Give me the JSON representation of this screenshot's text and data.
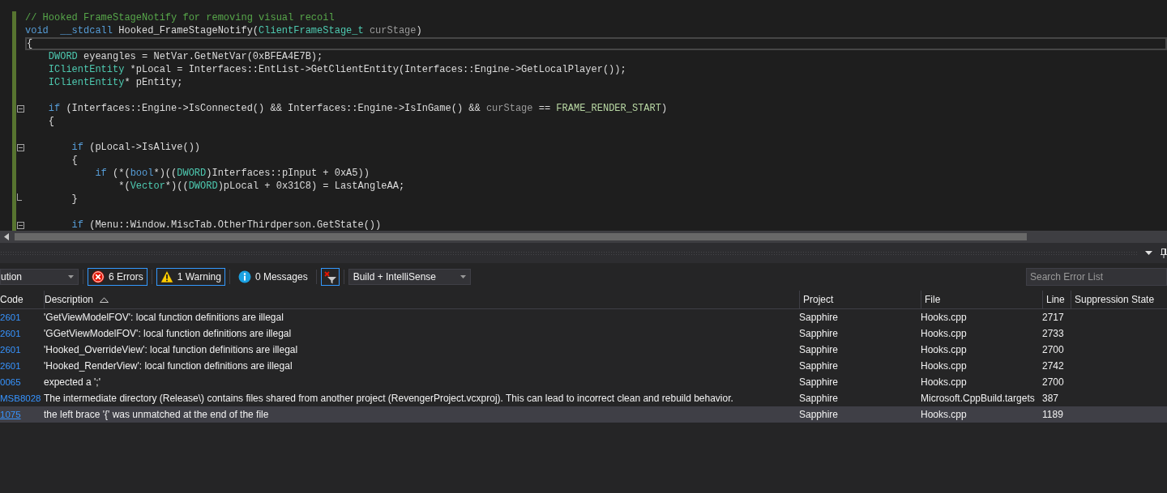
{
  "editor": {
    "lines": [
      {
        "changed": true,
        "tokens": [
          {
            "text": "// Hooked FrameStageNotify for removing visual recoil",
            "kind": "comment"
          }
        ]
      },
      {
        "changed": true,
        "tokens": [
          {
            "text": "void",
            "kind": "keyword"
          },
          {
            "text": "  __stdcall",
            "kind": "keyword"
          },
          {
            "text": " Hooked_FrameStageNotify(",
            "kind": "plain"
          },
          {
            "text": "ClientFrameStage_t",
            "kind": "type"
          },
          {
            "text": " curStage",
            "kind": "param"
          },
          {
            "text": ")",
            "kind": "plain"
          }
        ]
      },
      {
        "changed": true,
        "current": true,
        "tokens": [
          {
            "text": "{",
            "kind": "plain"
          }
        ]
      },
      {
        "changed": true,
        "tokens": [
          {
            "text": "    DWORD",
            "kind": "type"
          },
          {
            "text": " eyeangles = NetVar.GetNetVar(0xBFEA4E7B);",
            "kind": "plain"
          }
        ]
      },
      {
        "changed": true,
        "tokens": [
          {
            "text": "    IClientEntity",
            "kind": "type"
          },
          {
            "text": " *pLocal = Interfaces::EntList->GetClientEntity(Interfaces::Engine->GetLocalPlayer());",
            "kind": "plain"
          }
        ]
      },
      {
        "changed": true,
        "tokens": [
          {
            "text": "    IClientEntity",
            "kind": "type"
          },
          {
            "text": "* pEntity;",
            "kind": "plain"
          }
        ]
      },
      {
        "changed": true
      },
      {
        "changed": true,
        "expanded": true,
        "tokens": [
          {
            "text": "    if",
            "kind": "keyword"
          },
          {
            "text": " (Interfaces::Engine->IsConnected() && Interfaces::Engine->IsInGame() &&",
            "kind": "plain"
          },
          {
            "text": " curStage",
            "kind": "param"
          },
          {
            "text": " ==",
            "kind": "plain"
          },
          {
            "text": " FRAME_RENDER_START",
            "kind": "macro"
          },
          {
            "text": ")",
            "kind": "plain"
          }
        ]
      },
      {
        "changed": true,
        "tokens": [
          {
            "text": "    {",
            "kind": "plain"
          }
        ]
      },
      {
        "changed": true
      },
      {
        "changed": true,
        "expanded": true,
        "tokens": [
          {
            "text": "        if",
            "kind": "keyword"
          },
          {
            "text": " (pLocal->IsAlive())",
            "kind": "plain"
          }
        ]
      },
      {
        "changed": true,
        "tokens": [
          {
            "text": "        {",
            "kind": "plain"
          }
        ]
      },
      {
        "changed": true,
        "tokens": [
          {
            "text": "            if",
            "kind": "keyword"
          },
          {
            "text": " (*(",
            "kind": "plain"
          },
          {
            "text": "bool",
            "kind": "keyword"
          },
          {
            "text": "*)((",
            "kind": "plain"
          },
          {
            "text": "DWORD",
            "kind": "type"
          },
          {
            "text": ")Interfaces::pInput + 0xA5))",
            "kind": "plain"
          }
        ]
      },
      {
        "changed": true,
        "tokens": [
          {
            "text": "                *(",
            "kind": "plain"
          },
          {
            "text": "Vector",
            "kind": "type"
          },
          {
            "text": "*)((",
            "kind": "plain"
          },
          {
            "text": "DWORD",
            "kind": "type"
          },
          {
            "text": ")pLocal + 0x31C8) = LastAngleAA;",
            "kind": "plain"
          }
        ]
      },
      {
        "changed": true,
        "block_end": true,
        "tokens": [
          {
            "text": "        }",
            "kind": "plain"
          }
        ]
      },
      {
        "changed": true
      },
      {
        "changed": true,
        "expanded": true,
        "tokens": [
          {
            "text": "        if",
            "kind": "keyword"
          },
          {
            "text": " (Menu::Window.MiscTab.OtherThirdperson.GetState())",
            "kind": "plain"
          }
        ]
      }
    ]
  },
  "error_list": {
    "toolbar": {
      "scope": "ution",
      "filters": [
        {
          "kind": "error",
          "label": "6 Errors",
          "selected": true
        },
        {
          "kind": "warning",
          "label": "1 Warning",
          "selected": true
        },
        {
          "kind": "info",
          "label": "0 Messages",
          "selected": false
        }
      ],
      "source": "Build + IntelliSense",
      "search": {
        "placeholder": "Search Error List"
      }
    },
    "columns": [
      "Code",
      "Description",
      "Project",
      "File",
      "Line",
      "Suppression State"
    ],
    "rows": [
      {
        "code": "2601",
        "description": "'GetViewModelFOV': local function definitions are illegal",
        "project": "Sapphire",
        "file": "Hooks.cpp",
        "line": "2717",
        "selected": false
      },
      {
        "code": "2601",
        "description": "'GGetViewModelFOV': local function definitions are illegal",
        "project": "Sapphire",
        "file": "Hooks.cpp",
        "line": "2733",
        "selected": false
      },
      {
        "code": "2601",
        "description": "'Hooked_OverrideView': local function definitions are illegal",
        "project": "Sapphire",
        "file": "Hooks.cpp",
        "line": "2700",
        "selected": false
      },
      {
        "code": "2601",
        "description": "'Hooked_RenderView': local function definitions are illegal",
        "project": "Sapphire",
        "file": "Hooks.cpp",
        "line": "2742",
        "selected": false
      },
      {
        "code": "0065",
        "description": "expected a ';'",
        "project": "Sapphire",
        "file": "Hooks.cpp",
        "line": "2700",
        "selected": false
      },
      {
        "code": "MSB8028",
        "description": "The intermediate directory (Release\\) contains files shared from another project (RevengerProject.vcxproj).  This can lead to incorrect clean and rebuild behavior.",
        "project": "Sapphire",
        "file": "Microsoft.CppBuild.targets",
        "line": "387",
        "selected": false
      },
      {
        "code": "1075",
        "description": "the left brace '{' was unmatched at the end of the file",
        "project": "Sapphire",
        "file": "Hooks.cpp",
        "line": "1189",
        "selected": true
      }
    ]
  }
}
